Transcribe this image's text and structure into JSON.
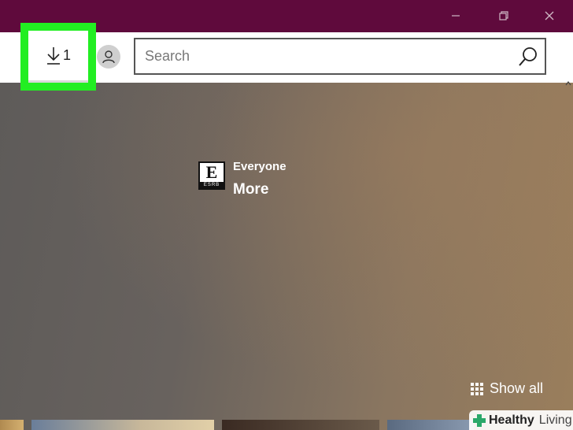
{
  "window": {
    "minimize_icon": "minimize-icon",
    "restore_icon": "restore-icon",
    "close_icon": "close-icon",
    "titlebar_color": "#5f0a3c"
  },
  "toolbar": {
    "downloads_count": "1",
    "downloads_icon": "download-arrow-icon",
    "account_icon": "user-icon",
    "highlight_color": "#22ee22"
  },
  "search": {
    "placeholder": "Search",
    "value": "",
    "icon": "search-icon"
  },
  "rating": {
    "esrb_letter": "E",
    "esrb_band": "ESRB",
    "label": "Everyone",
    "more_label": "More"
  },
  "actions": {
    "show_all_label": "Show all",
    "show_all_icon": "grid-icon"
  },
  "watermark": {
    "brand_strong": "Healthy",
    "brand_light": "Living",
    "logo_icon": "cross-icon",
    "logo_color": "#2aa86a"
  }
}
